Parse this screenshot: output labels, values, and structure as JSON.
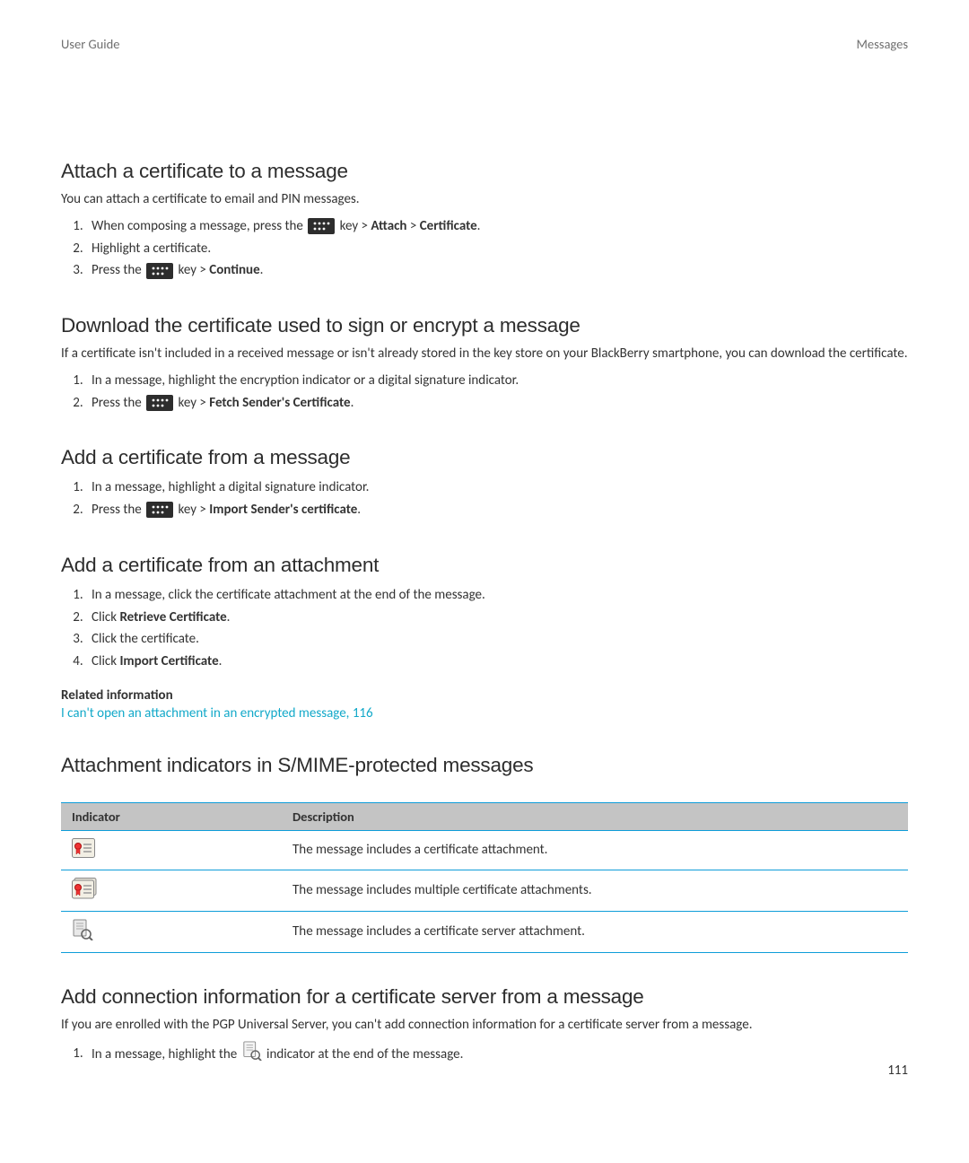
{
  "header": {
    "left": "User Guide",
    "right": "Messages"
  },
  "s1": {
    "title": "Attach a certificate to a message",
    "intro": "You can attach a certificate to email and PIN messages.",
    "step1a": "When composing a message, press the ",
    "step1b": " key > ",
    "step1_attach": "Attach",
    "step1_sep": " > ",
    "step1_cert": "Certificate",
    "step1c": ".",
    "step2": "Highlight a certificate.",
    "step3a": "Press the ",
    "step3b": " key > ",
    "step3_cont": "Continue",
    "step3c": "."
  },
  "s2": {
    "title": "Download the certificate used to sign or encrypt a message",
    "intro": "If a certificate isn't included in a received message or isn't already stored in the key store on your BlackBerry smartphone, you can download the certificate.",
    "step1": "In a message, highlight the encryption indicator or a digital signature indicator.",
    "step2a": "Press the ",
    "step2b": " key > ",
    "step2_fetch": "Fetch Sender's Certificate",
    "step2c": "."
  },
  "s3": {
    "title": "Add a certificate from a message",
    "step1": "In a message, highlight a digital signature indicator.",
    "step2a": "Press the ",
    "step2b": " key > ",
    "step2_import": "Import Sender's certificate",
    "step2c": "."
  },
  "s4": {
    "title": "Add a certificate from an attachment",
    "step1": "In a message, click the certificate attachment at the end of the message.",
    "step2a": "Click ",
    "step2_retrieve": "Retrieve Certificate",
    "step2b": ".",
    "step3": "Click the certificate.",
    "step4a": "Click ",
    "step4_import": "Import Certificate",
    "step4b": "."
  },
  "related": {
    "heading": "Related information",
    "link": "I can't open an attachment in an encrypted message, 116"
  },
  "s5": {
    "title": "Attachment indicators in S/MIME-protected messages",
    "th1": "Indicator",
    "th2": "Description",
    "r1": "The message includes a certificate attachment.",
    "r2": "The message includes multiple certificate attachments.",
    "r3": "The message includes a certificate server attachment."
  },
  "s6": {
    "title": "Add connection information for a certificate server from a message",
    "intro": "If you are enrolled with the PGP Universal Server, you can't add connection information for a certificate server from a message.",
    "step1a": "In a message, highlight the ",
    "step1b": " indicator at the end of the message."
  },
  "pagenum": "111"
}
